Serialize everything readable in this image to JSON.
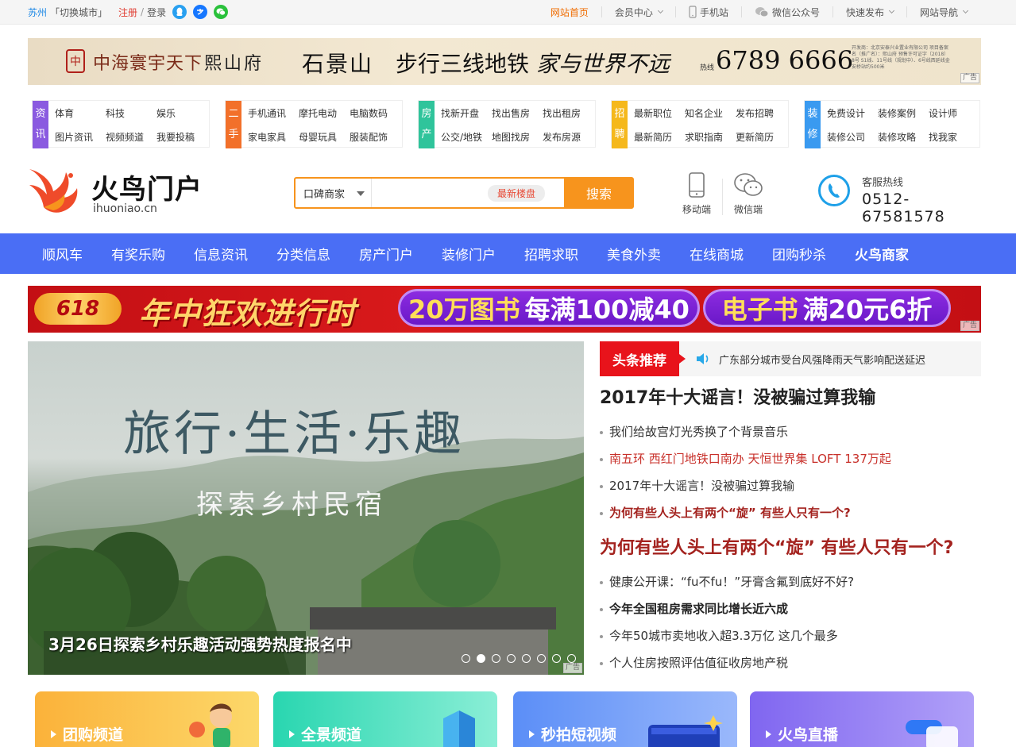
{
  "topbar": {
    "city": "苏州",
    "switch_city": "「切换城市」",
    "register": "注册",
    "sep": "/",
    "login": "登录",
    "links": [
      {
        "label": "网站首页",
        "icon": ""
      },
      {
        "label": "会员中心",
        "icon": "chevron-down"
      },
      {
        "label": "手机站",
        "icon": "mobile-icon"
      },
      {
        "label": "微信公众号",
        "icon": "wechat-icon"
      },
      {
        "label": "快速发布",
        "icon": "chevron-down"
      },
      {
        "label": "网站导航",
        "icon": "chevron-down"
      }
    ],
    "social_icons": [
      "qq-icon",
      "alipay-icon",
      "wechat-icon"
    ]
  },
  "banner1": {
    "logo_char": "中",
    "brand": "中海寰宇天下",
    "project": "熙山府",
    "location": "石景山",
    "slogan": "步行三线地铁",
    "tagline": "家与世界不远",
    "hotline_label": "热线",
    "phone": "6789 6666",
    "fine_print": "开发商：北京安泰兴业置业有限公司 项目备案名（推广名）：熙山府 预售许可证字（2018）8号 S1线、11号线（规划中）、6号线西延线金安桥站约500米",
    "ad_tag": "广告"
  },
  "categories": [
    {
      "tag": [
        "资",
        "讯"
      ],
      "color": "#8a5ae0",
      "items": [
        "体育",
        "科技",
        "娱乐",
        "图片资讯",
        "视频频道",
        "我要投稿"
      ]
    },
    {
      "tag": [
        "二",
        "手"
      ],
      "color": "#f2702a",
      "items": [
        "手机通讯",
        "摩托电动",
        "电脑数码",
        "家电家具",
        "母婴玩具",
        "服装配饰"
      ]
    },
    {
      "tag": [
        "房",
        "产"
      ],
      "color": "#2fc49b",
      "items": [
        "找新开盘",
        "找出售房",
        "找出租房",
        "公交/地铁",
        "地图找房",
        "发布房源"
      ]
    },
    {
      "tag": [
        "招",
        "聘"
      ],
      "color": "#f5b81c",
      "items": [
        "最新职位",
        "知名企业",
        "发布招聘",
        "最新简历",
        "求职指南",
        "更新简历"
      ]
    },
    {
      "tag": [
        "装",
        "修"
      ],
      "color": "#3a9af0",
      "items": [
        "免费设计",
        "装修案例",
        "设计师",
        "装修公司",
        "装修攻略",
        "找我家"
      ]
    }
  ],
  "header": {
    "logo_text": "火鸟门户",
    "logo_url": "ihuoniao.cn",
    "search_select": "口碑商家",
    "search_placeholder": "",
    "search_hot": "最新楼盘",
    "search_button": "搜索",
    "mobile_label": "移动端",
    "wechat_label": "微信端",
    "hotline_label": "客服热线",
    "hotline_number": "0512-67581578"
  },
  "nav": [
    "顺风车",
    "有奖乐购",
    "信息资讯",
    "分类信息",
    "房产门户",
    "装修门户",
    "招聘求职",
    "美食外卖",
    "在线商城",
    "团购秒杀",
    "火鸟商家"
  ],
  "banner2": {
    "badge": "618",
    "slogan": "年中狂欢进行时",
    "offer1_a": "20万图书",
    "offer1_b": "每满100减40",
    "offer2_a": "电子书",
    "offer2_b": "满20元6折",
    "ad_tag": "广告"
  },
  "hero": {
    "title": "旅行·生活·乐趣",
    "subtitle": "探索乡村民宿",
    "caption": "3月26日探索乡村乐趣活动强势热度报名中",
    "slide_count": 8,
    "active_slide": 2,
    "ad_tag": "广告"
  },
  "news": {
    "tag": "头条推荐",
    "marquee": "广东部分城市受台风强降雨天气影响配送延迟",
    "headline1": "2017年十大谣言！没被骗过算我输",
    "list1": [
      {
        "text": "我们给故宫灯光秀换了个背景音乐",
        "style": ""
      },
      {
        "text": "南五环 西红门地铁口南办 天恒世界集 LOFT 137万起",
        "style": "red"
      },
      {
        "text": "2017年十大谣言！没被骗过算我输",
        "style": ""
      },
      {
        "text": "为何有些人头上有两个“旋” 有些人只有一个?",
        "style": "brown"
      }
    ],
    "headline2": "为何有些人头上有两个“旋” 有些人只有一个?",
    "list2": [
      {
        "text": "健康公开课：“fu不fu！”牙膏含氟到底好不好?",
        "style": ""
      },
      {
        "text": "今年全国租房需求同比增长近六成",
        "style": "b"
      },
      {
        "text": "今年50城市卖地收入超3.3万亿 这几个最多",
        "style": ""
      },
      {
        "text": "个人住房按照评估值征收房地产税",
        "style": ""
      }
    ]
  },
  "channels": [
    {
      "label": "团购频道",
      "color1": "#fbb23a",
      "color2": "#fcd86a"
    },
    {
      "label": "全景频道",
      "color1": "#29d6b0",
      "color2": "#7be8cf"
    },
    {
      "label": "秒拍短视频",
      "color1": "#5b8ef7",
      "color2": "#8fb2fb"
    },
    {
      "label": "火鸟直播",
      "color1": "#8066f0",
      "color2": "#a996f7"
    }
  ]
}
